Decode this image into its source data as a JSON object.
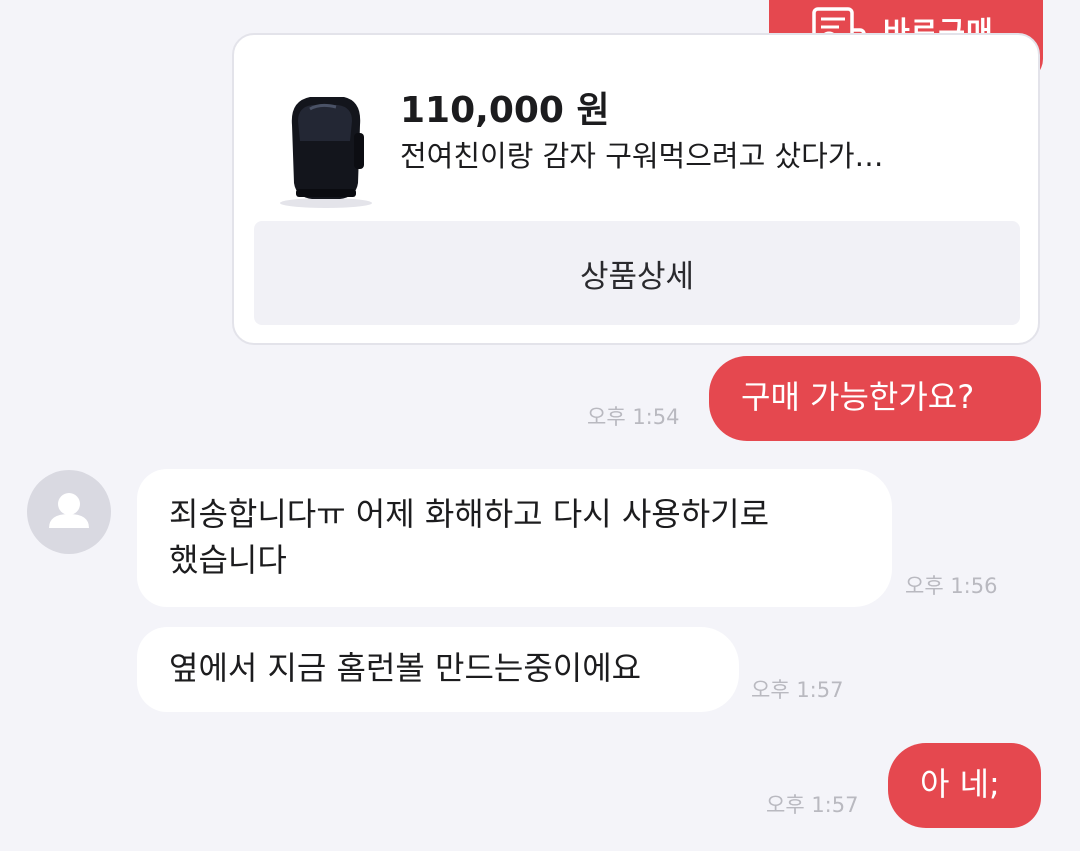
{
  "product": {
    "buy_now_label": "바로구매",
    "price": "110,000 원",
    "title": "전여친이랑 감자 구워먹으려고 샀다가…",
    "detail_button_label": "상품상세"
  },
  "messages": [
    {
      "sender": "me",
      "text": "구매 가능한가요?",
      "time": "오후 1:54"
    },
    {
      "sender": "seller",
      "lines": [
        "죄송합니다ㅠ 어제 화해하고 다시 사용하기로",
        "했습니다"
      ],
      "time": "오후 1:56"
    },
    {
      "sender": "seller",
      "text": "옆에서 지금 홈런볼 만드는중이에요",
      "time": "오후 1:57"
    },
    {
      "sender": "me",
      "text": "아 네;",
      "time": "오후 1:57"
    }
  ],
  "colors": {
    "accent": "#e5484f",
    "background": "#f4f4f9",
    "bubble_other": "#ffffff",
    "timestamp": "#b9b9c0"
  },
  "icons": {
    "buy_now": "receipt-won-icon",
    "avatar": "user-placeholder-icon",
    "product": "air-fryer-product-image"
  }
}
